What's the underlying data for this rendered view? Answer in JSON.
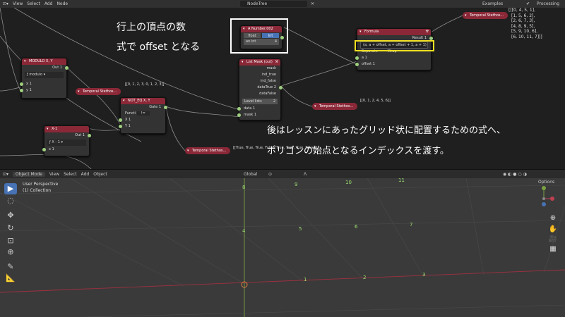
{
  "node_editor": {
    "menus": [
      "View",
      "Select",
      "Add",
      "Node"
    ],
    "tree_name": "NodeTree",
    "examples": "Examples",
    "processing": "Processing",
    "output_text": [
      "[[[0, 4, 5, 1],",
      "[1, 5, 6, 2],",
      "[2, 6, 7, 3],",
      "[4, 8, 9, 5],",
      "[5, 9, 10, 6],",
      "[6, 10, 11, 7]]]"
    ]
  },
  "nodes": {
    "a_number": {
      "title": "A Number.002",
      "mode_int": "Int",
      "mode_float": "float",
      "label": "an int",
      "value": "4"
    },
    "formula": {
      "title": "Formula",
      "result": "Result",
      "result_val": "1",
      "expr": "(a, a + offset, a + offset + 1, a + 1)",
      "separate": "Separate",
      "wrap": "Wrap",
      "in_a": "a",
      "in_a_val": "1",
      "in_offset": "offset",
      "in_offset_val": "1"
    },
    "list_mask": {
      "title": "List Mask (out)",
      "outs": [
        "mask",
        "ind_true",
        "ind_false",
        "dataTrue",
        "dataFalse"
      ],
      "datatrue_val": "2",
      "level_label": "Level lists",
      "level_val": "2",
      "in_data": "data",
      "in_data_val": "1",
      "in_mask": "mask",
      "in_mask_val": "1"
    },
    "modulo": {
      "title": "MODULO X, Y",
      "out": "Out",
      "out_val": "1",
      "mode": "modulo",
      "in_x": "x",
      "in_x_val": "1",
      "in_y": "y",
      "in_y_val": "1"
    },
    "not_eq": {
      "title": "NOT_EQ X, Y",
      "gate": "Gate",
      "gate_val": "1",
      "func_label": "Functi",
      "func_val": "!=",
      "in_x": "X",
      "in_x_val": "1",
      "in_y": "Y",
      "in_y_val": "1"
    },
    "x1": {
      "title": "X-1",
      "out": "Out",
      "out_val": "1",
      "mode": "X - 1",
      "in_x": "x",
      "in_x_val": "1"
    }
  },
  "viewers": [
    "Temporal Stethos...",
    "Temporal Stethos...",
    "Temporal Stethos...",
    "Temporal Stethos...",
    "Temporal Stethos..."
  ],
  "texts": {
    "list1": "[[0, 1, 2, 3, 0, 1, 2, 3]]",
    "list2": "[[0, 1, 2, 4, 5, 6]]",
    "bools": "[[True, True, True, False, True, True, True, False]]"
  },
  "annotations": {
    "box_line1": "行上の頂点の数",
    "box_line2": "式で offset となる",
    "bottom_line1": "後はレッスンにあったグリッド状に配置するための式へ、",
    "bottom_line2": "ポリゴンの始点となるインデックスを渡す。"
  },
  "viewport": {
    "mode": "Object Mode",
    "menus": [
      "View",
      "Select",
      "Add",
      "Object"
    ],
    "transform": "Global",
    "options": "Options",
    "perspective": "User Perspective",
    "collection": "(1) Collection",
    "vertex_indices": [
      "1",
      "2",
      "3",
      "4",
      "5",
      "6",
      "7",
      "8",
      "9",
      "10",
      "11"
    ]
  },
  "colors": {
    "node_header": "#8a2837",
    "highlight": "#f0e020",
    "socket": "#a0d080",
    "index": "#9de070"
  }
}
